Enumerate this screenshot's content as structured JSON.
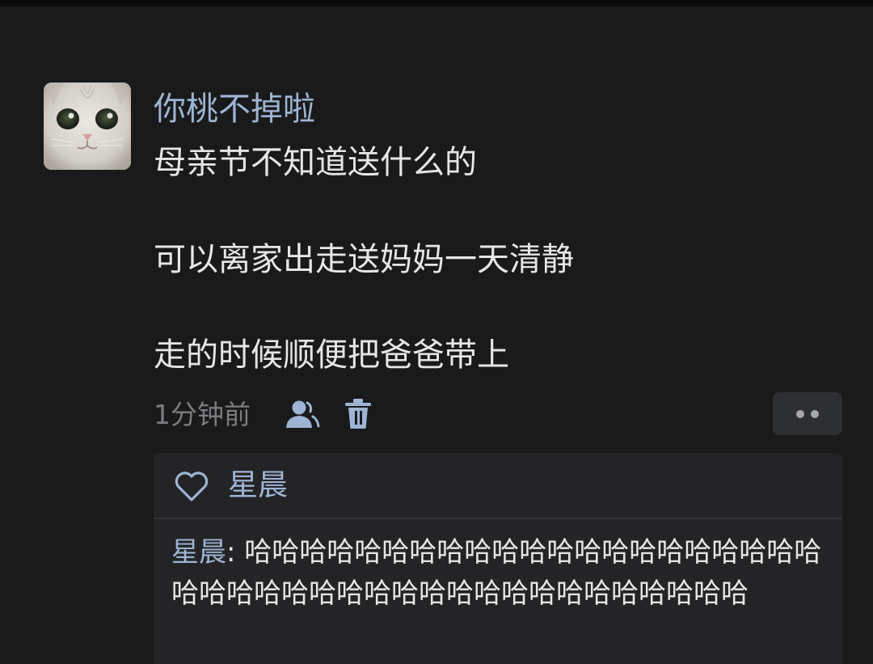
{
  "post": {
    "avatar_icon": "cat-face-avatar",
    "username": "你桃不掉啦",
    "lines": [
      "母亲节不知道送什么的",
      "可以离家出走送妈妈一天清静",
      "走的时候顺便把爸爸带上"
    ],
    "time": "1分钟前",
    "icons": {
      "follow": "user-icon",
      "delete": "trash-icon",
      "more": "more-dots-icon"
    }
  },
  "reply_panel": {
    "like_icon": "heart-icon",
    "liker": "星晨",
    "reply": {
      "author": "星晨",
      "separator": ": ",
      "text": "哈哈哈哈哈哈哈哈哈哈哈哈哈哈哈哈哈哈哈哈哈哈哈哈哈哈哈哈哈哈哈哈哈哈哈哈哈哈哈哈哈哈"
    }
  },
  "colors": {
    "background": "#1a1a1b",
    "name_accent": "#9db4d4",
    "body_text": "#e6e6e6",
    "muted_text": "#7c7c80",
    "panel_bg": "#242426"
  }
}
